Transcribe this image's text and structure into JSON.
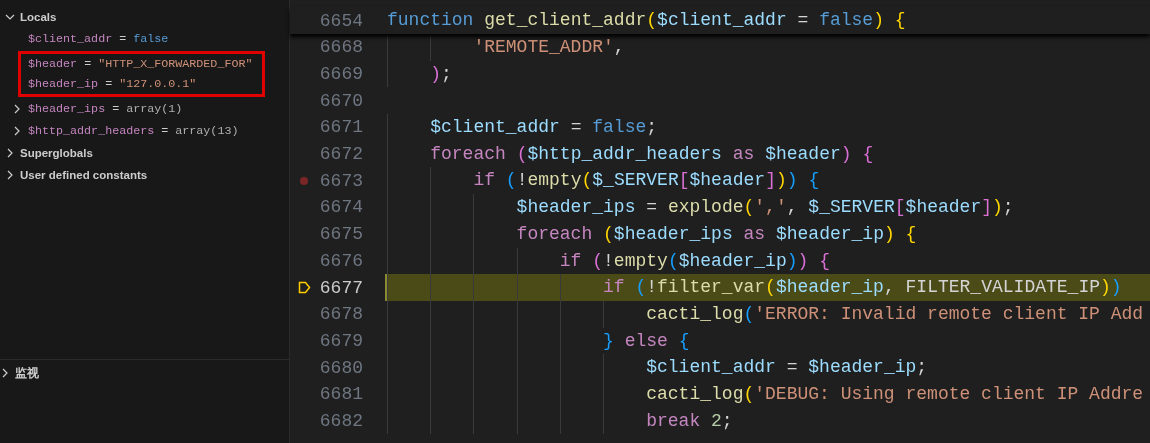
{
  "variables": {
    "sections": [
      {
        "label": "Locals",
        "expanded": true,
        "variables": [
          {
            "name": "$client_addr",
            "op": "=",
            "value": "false",
            "kind": "boolean",
            "boxed": false
          },
          {
            "name": "$header",
            "op": "=",
            "value": "\"HTTP_X_FORWARDED_FOR\"",
            "kind": "string",
            "boxed": true
          },
          {
            "name": "$header_ip",
            "op": "=",
            "value": "\"127.0.0.1\"",
            "kind": "string",
            "boxed": true
          },
          {
            "name": "$header_ips",
            "op": "=",
            "value": "array(1)",
            "kind": "array",
            "expanded": false,
            "boxed": false
          },
          {
            "name": "$http_addr_headers",
            "op": "=",
            "value": "array(13)",
            "kind": "array",
            "expanded": false,
            "boxed": false
          }
        ]
      },
      {
        "label": "Superglobals",
        "expanded": false
      },
      {
        "label": "User defined constants",
        "expanded": false
      }
    ]
  },
  "watch": {
    "label": "监视",
    "expanded": false
  },
  "editor": {
    "sticky_line": {
      "number": "6654",
      "text": "function get_client_addr($client_addr = false) {"
    },
    "lines": [
      {
        "number": "6668",
        "current": false,
        "breakpoint": false,
        "text": "        'REMOTE_ADDR',"
      },
      {
        "number": "6669",
        "current": false,
        "breakpoint": false,
        "text": "    );"
      },
      {
        "number": "6670",
        "current": false,
        "breakpoint": false
      },
      {
        "number": "6671",
        "current": false,
        "breakpoint": false,
        "text": "    $client_addr = false;"
      },
      {
        "number": "6672",
        "current": false,
        "breakpoint": false,
        "text": "    foreach ($http_addr_headers as $header) {"
      },
      {
        "number": "6673",
        "current": false,
        "breakpoint": true,
        "text": "        if (!empty($_SERVER[$header])) {"
      },
      {
        "number": "6674",
        "current": false,
        "breakpoint": false,
        "text": "            $header_ips = explode(',', $_SERVER[$header]);"
      },
      {
        "number": "6675",
        "current": false,
        "breakpoint": false,
        "text": "            foreach ($header_ips as $header_ip) {"
      },
      {
        "number": "6676",
        "current": false,
        "breakpoint": false,
        "text": "                if (!empty($header_ip)) {"
      },
      {
        "number": "6677",
        "current": true,
        "breakpoint": false,
        "text": "                    if (!filter_var($header_ip, FILTER_VALIDATE_IP))"
      },
      {
        "number": "6678",
        "current": false,
        "breakpoint": false,
        "text": "                        cacti_log('ERROR: Invalid remote client IP Add"
      },
      {
        "number": "6679",
        "current": false,
        "breakpoint": false,
        "text": "                    } else {"
      },
      {
        "number": "6680",
        "current": false,
        "breakpoint": false,
        "text": "                        $client_addr = $header_ip;"
      },
      {
        "number": "6681",
        "current": false,
        "breakpoint": false,
        "text": "                        cacti_log('DEBUG: Using remote client IP Addre"
      },
      {
        "number": "6682",
        "current": false,
        "breakpoint": false,
        "text": "                        break 2;"
      }
    ]
  }
}
